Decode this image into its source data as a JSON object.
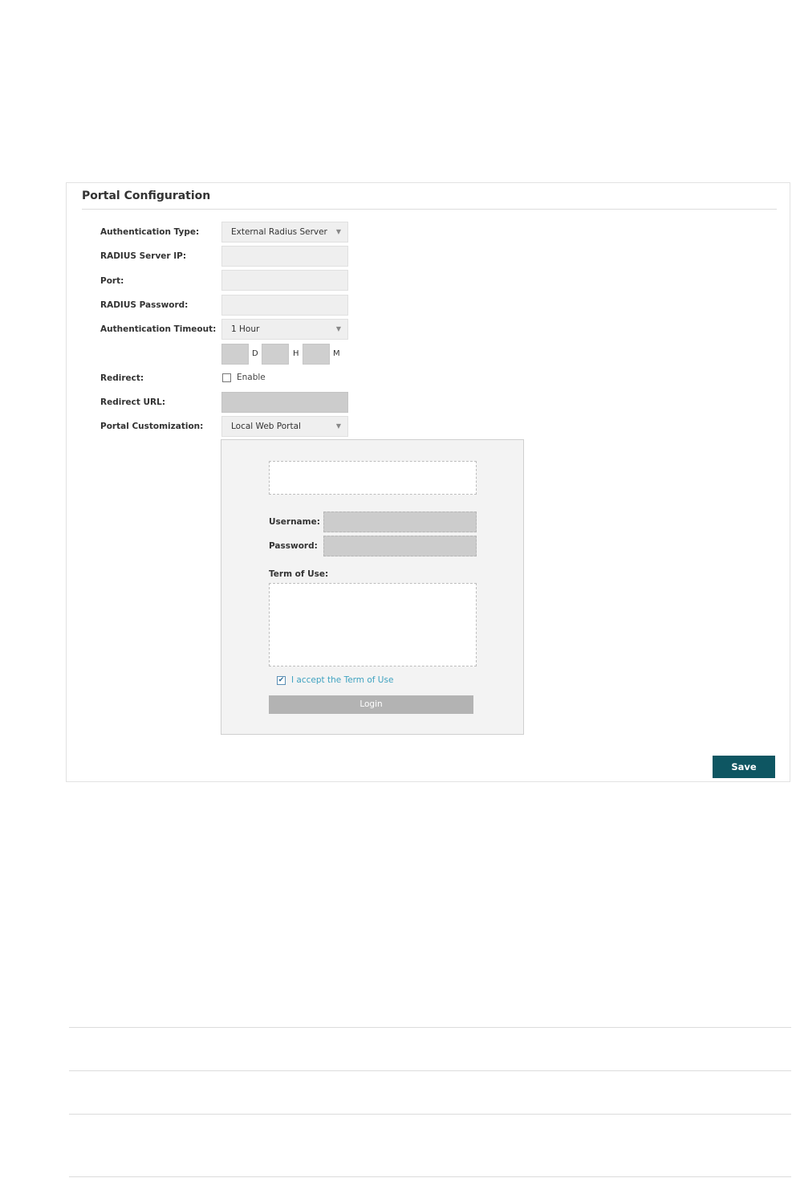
{
  "panel": {
    "title": "Portal Configuration"
  },
  "form": {
    "auth_type_label": "Authentication Type:",
    "auth_type_value": "External Radius Server",
    "radius_ip_label": "RADIUS Server IP:",
    "port_label": "Port:",
    "radius_password_label": "RADIUS Password:",
    "auth_timeout_label": "Authentication Timeout:",
    "auth_timeout_value": "1 Hour",
    "unit_d": "D",
    "unit_h": "H",
    "unit_m": "M",
    "redirect_label": "Redirect:",
    "redirect_enable_label": "Enable",
    "redirect_url_label": "Redirect URL:",
    "portal_custom_label": "Portal Customization:",
    "portal_custom_value": "Local Web Portal"
  },
  "preview": {
    "username_label": "Username:",
    "password_label": "Password:",
    "term_label": "Term of Use:",
    "accept_label": "I accept the Term of Use",
    "login_label": "Login"
  },
  "actions": {
    "save_label": "Save"
  },
  "icons": {
    "dropdown": "chevron-down-icon",
    "checkmark": "checkmark-icon"
  },
  "colors": {
    "save_button": "#0e5662",
    "accept_link": "#3fa2c0",
    "login_button": "#b3b3b3"
  }
}
